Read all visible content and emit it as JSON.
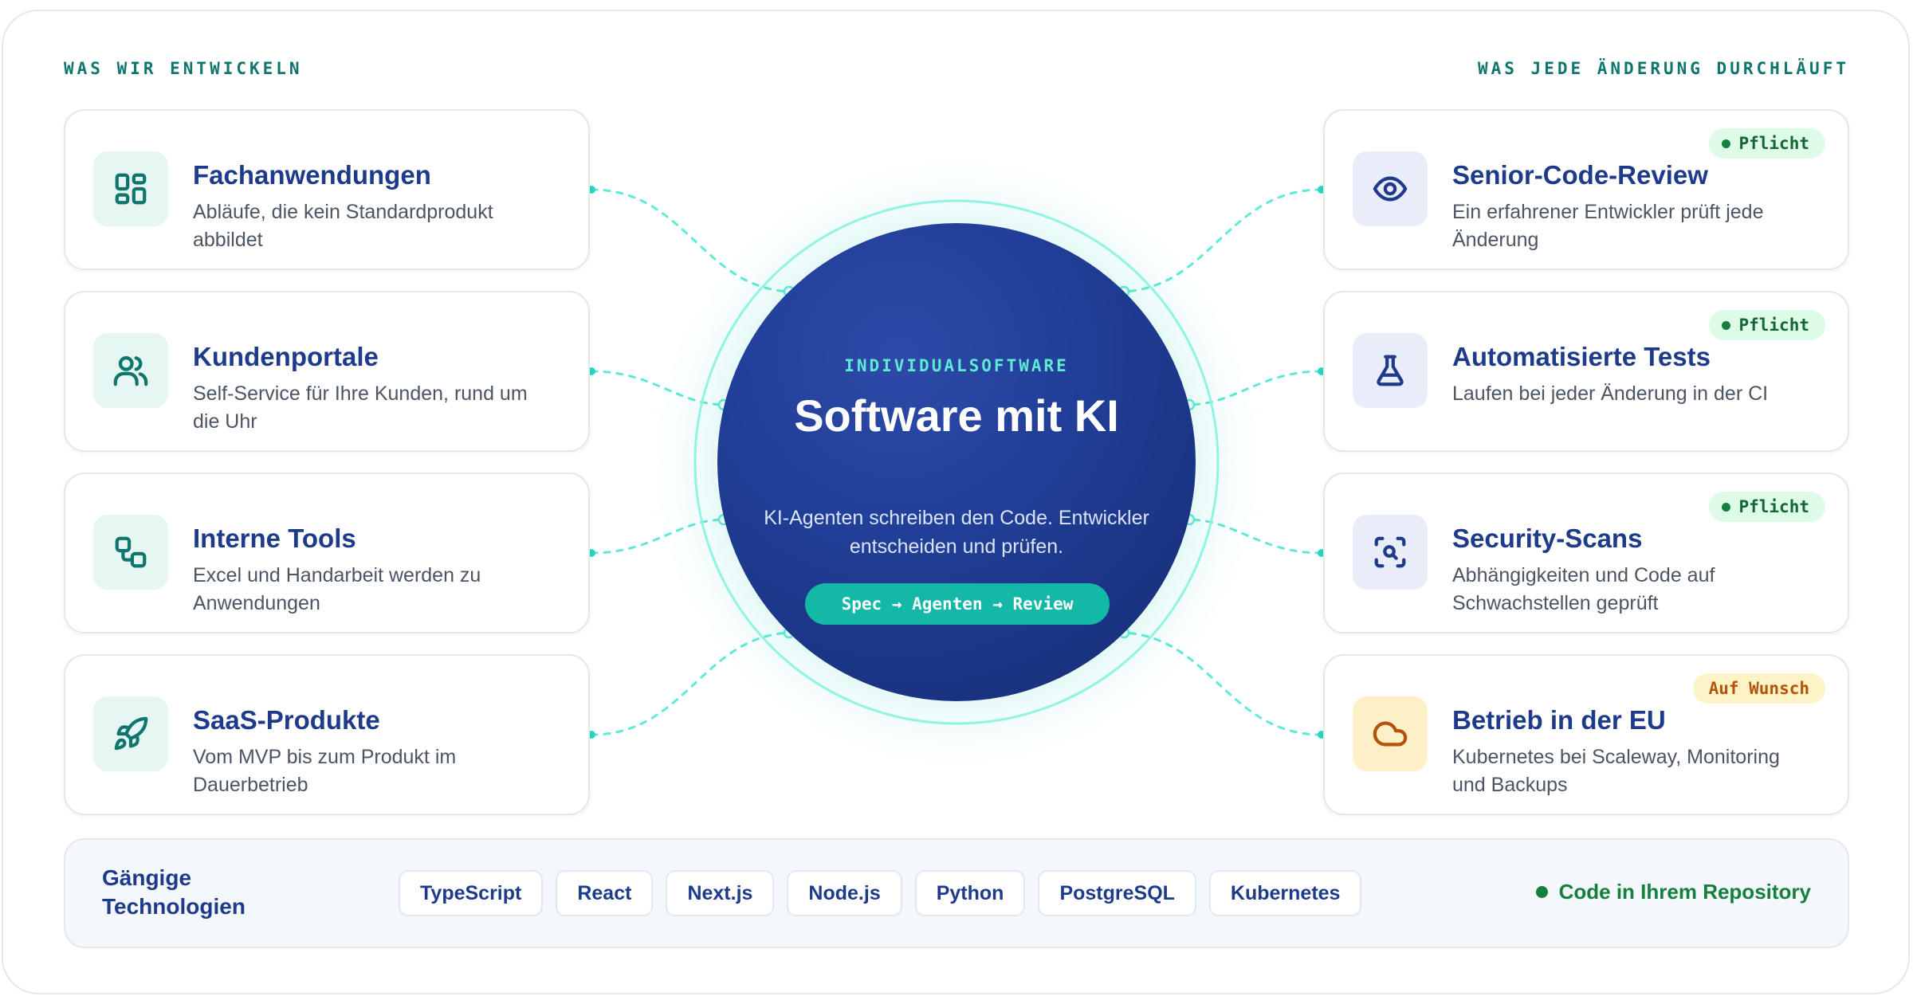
{
  "headings": {
    "left": "WAS WIR ENTWICKELN",
    "right": "WAS JEDE ÄNDERUNG DURCHLÄUFT"
  },
  "left_cards": [
    {
      "icon": "grid-icon",
      "title": "Fachanwendungen",
      "desc": "Abläufe, die kein Standardprodukt abbildet"
    },
    {
      "icon": "users-icon",
      "title": "Kundenportale",
      "desc": "Self-Service für Ihre Kunden, rund um die Uhr"
    },
    {
      "icon": "workflow-icon",
      "title": "Interne Tools",
      "desc": "Excel und Handarbeit werden zu Anwendungen"
    },
    {
      "icon": "rocket-icon",
      "title": "SaaS-Produkte",
      "desc": "Vom MVP bis zum Produkt im Dauerbetrieb"
    }
  ],
  "right_cards": [
    {
      "icon": "eye-icon",
      "title": "Senior-Code-Review",
      "desc": "Ein erfahrener Entwickler prüft jede Änderung",
      "badge": "Pflicht",
      "badge_style": "green"
    },
    {
      "icon": "flask-icon",
      "title": "Automatisierte Tests",
      "desc": "Laufen bei jeder Änderung in der CI",
      "badge": "Pflicht",
      "badge_style": "green"
    },
    {
      "icon": "scan-search-icon",
      "title": "Security-Scans",
      "desc": "Abhängigkeiten und Code auf Schwachstellen geprüft",
      "badge": "Pflicht",
      "badge_style": "green"
    },
    {
      "icon": "cloud-icon",
      "title": "Betrieb in der EU",
      "desc": "Kubernetes bei Scaleway, Monitoring und Backups",
      "badge": "Auf Wunsch",
      "badge_style": "amber"
    }
  ],
  "center": {
    "eyebrow": "INDIVIDUALSOFTWARE",
    "title": "Software mit KI",
    "desc": "KI-Agenten schreiben den Code. Entwickler entscheiden und prüfen.",
    "pill": "Spec → Agenten → Review"
  },
  "tech": {
    "label": "Gängige Technologien",
    "chips": [
      "TypeScript",
      "React",
      "Next.js",
      "Node.js",
      "Python",
      "PostgreSQL",
      "Kubernetes"
    ],
    "repo": "Code in Ihrem Repository"
  },
  "colors": {
    "navy": "#1e3a8a",
    "teal": "#0f766e",
    "teal_bright": "#14b8a6",
    "green": "#15803d",
    "amber": "#b45309"
  }
}
